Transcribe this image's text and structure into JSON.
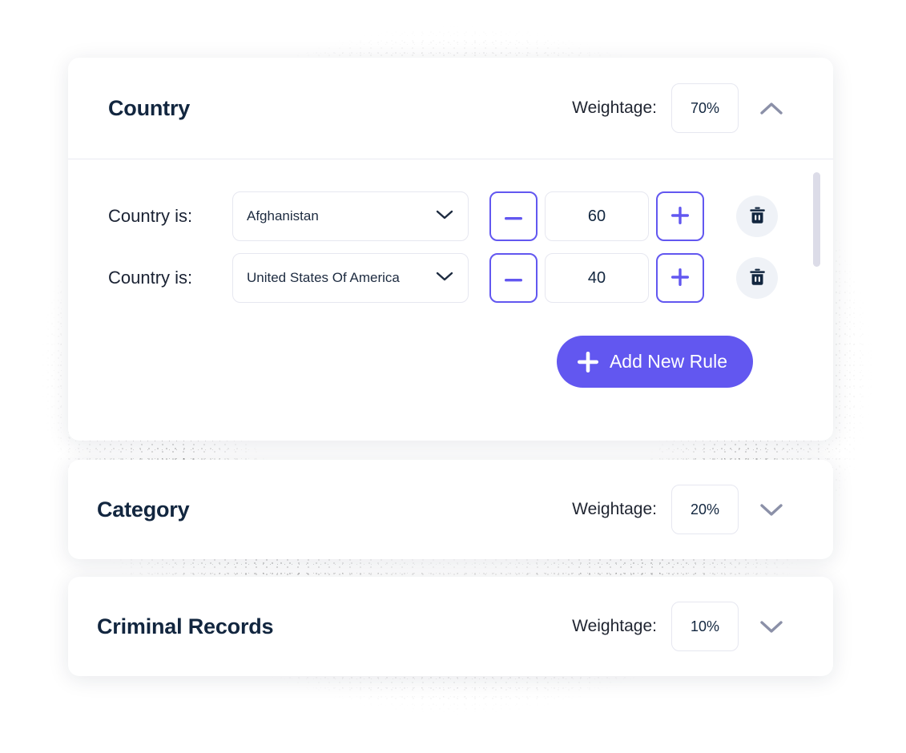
{
  "panels": [
    {
      "title": "Country",
      "weightage_label": "Weightage:",
      "weightage_value": "70%",
      "expanded": true,
      "toggle_icon": "chevron-up-icon",
      "rules": [
        {
          "label": "Country is:",
          "select_value": "Afghanistan",
          "dropdown_icon": "chevron-down-icon",
          "decrement_label": "−",
          "score": "60",
          "increment_label": "+",
          "delete_icon": "trash-icon"
        },
        {
          "label": "Country is:",
          "select_value": "United States Of America",
          "dropdown_icon": "chevron-down-icon",
          "decrement_label": "−",
          "score": "40",
          "increment_label": "+",
          "delete_icon": "trash-icon"
        }
      ],
      "add_rule_label": "Add New Rule",
      "add_rule_icon": "plus-icon"
    },
    {
      "title": "Category",
      "weightage_label": "Weightage:",
      "weightage_value": "20%",
      "expanded": false,
      "toggle_icon": "chevron-down-icon"
    },
    {
      "title": "Criminal Records",
      "weightage_label": "Weightage:",
      "weightage_value": "10%",
      "expanded": false,
      "toggle_icon": "chevron-down-icon"
    }
  ],
  "colors": {
    "accent": "#6257f0",
    "title": "#12263f",
    "border": "#e6e7f0",
    "chevron": "#8b90a8",
    "trash_bg": "#eff2f7",
    "trash_icon": "#12263f",
    "scrollbar": "#dcdce8"
  }
}
